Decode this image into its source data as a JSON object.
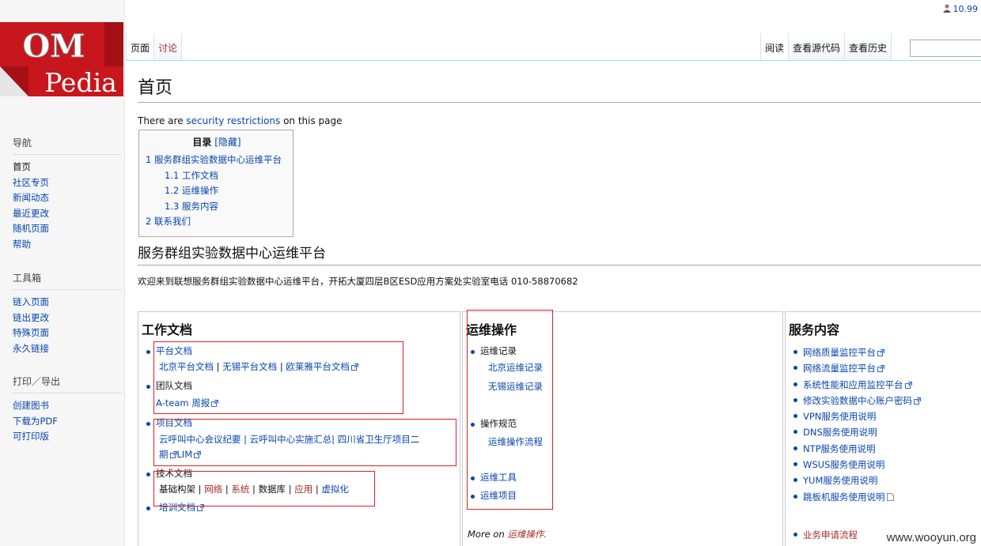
{
  "logo": {
    "top": "OM",
    "bottom": "Pedia"
  },
  "personal": {
    "user": "10.99"
  },
  "tabs": {
    "page": "页面",
    "talk": "讨论",
    "read": "阅读",
    "view_source": "查看源代码",
    "history": "查看历史"
  },
  "nav": {
    "heading": "导航",
    "items": [
      "首页",
      "社区专页",
      "新闻动态",
      "最近更改",
      "随机页面",
      "帮助"
    ]
  },
  "tools": {
    "heading": "工具箱",
    "items": [
      "链入页面",
      "链出更改",
      "特殊页面",
      "永久链接"
    ]
  },
  "print": {
    "heading": "打印／导出",
    "items": [
      "创建图书",
      "下载为PDF",
      "可打印版"
    ]
  },
  "page": {
    "title": "首页",
    "restrict_pre": "There are ",
    "restrict_link": "security restrictions",
    "restrict_post": " on this page"
  },
  "toc": {
    "title": "目录",
    "toggle": "[隐藏]",
    "items": [
      "1 服务群组实验数据中心运维平台",
      "1.1 工作文档",
      "1.2 运维操作",
      "1.3 服务内容",
      "2 联系我们"
    ]
  },
  "section": {
    "heading": "服务群组实验数据中心运维平台",
    "welcome": "欢迎来到联想服务群组实验数据中心运维平台，开拓大厦四层B区ESD应用方案处实验室电话 010-58870682"
  },
  "col1": {
    "heading": "工作文档",
    "platform": "平台文档",
    "platform_links": [
      "北京平台文档",
      "无锡平台文档",
      "欧莱雅平台文档"
    ],
    "team": "团队文档",
    "team_link": "A-team 周报",
    "project": "项目文档",
    "project_line1": "云呼叫中心会议纪要 | 云呼叫中心实施汇总| 四川省卫生厅项目二",
    "project_line2": "期",
    "project_lim": "LIM",
    "tech": "技术文档",
    "tech_links": [
      "基础构架",
      "网络",
      "系统",
      "数据库",
      "应用",
      "虚拟化"
    ],
    "training": "培训文档"
  },
  "col2": {
    "heading": "运维操作",
    "records": "运维记录",
    "records_sub": [
      "北京运维记录",
      "无锡运维记录"
    ],
    "spec": "操作规范",
    "spec_sub": "运维操作流程",
    "tools": "运维工具",
    "items": "运维项目",
    "more_pre": "More on ",
    "more_link": "运维操作."
  },
  "col3": {
    "heading": "服务内容",
    "items": [
      "网络质量监控平台",
      "网络流量监控平台",
      "系统性能和应用监控平台",
      "修改实验数据中心账户密码",
      "VPN服务使用说明",
      "DNS服务使用说明",
      "NTP服务使用说明",
      "WSUS服务使用说明",
      "YUM服务使用说明",
      "跳板机服务使用说明"
    ],
    "request": "业务申请流程"
  },
  "watermark": "www.wooyun.org",
  "colors": {
    "link": "#0645ad",
    "red_link": "#a52a2a",
    "annotation": "#dd2222",
    "logo_red": "#d71920"
  }
}
